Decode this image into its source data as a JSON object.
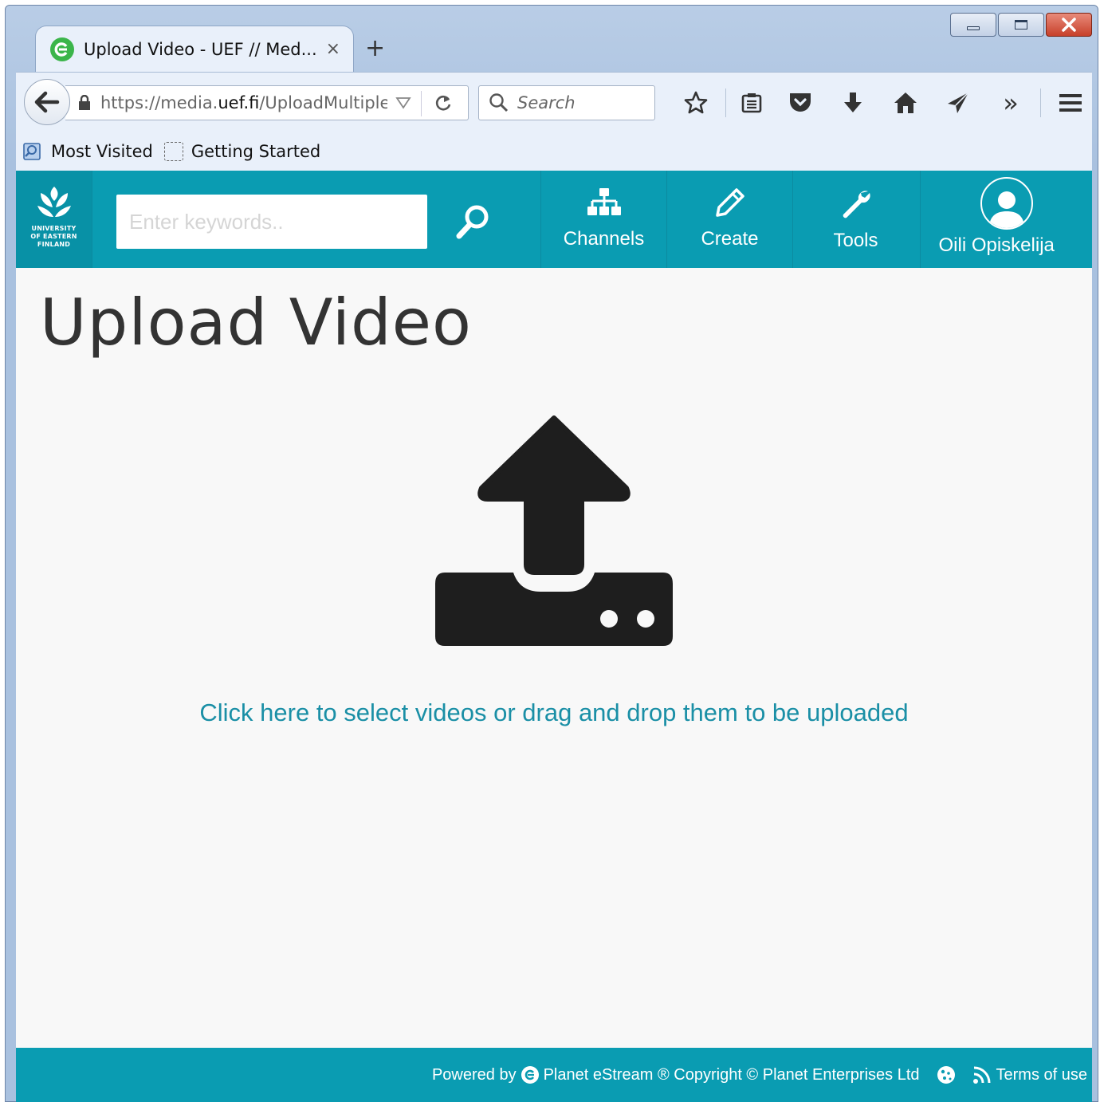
{
  "browser": {
    "tab_title": "Upload Video - UEF // Med...",
    "tab_close": "×",
    "new_tab": "+",
    "url_prefix": "https://media.",
    "url_domain": "uef.fi",
    "url_path": "/UploadMultiple",
    "search_placeholder": "Search",
    "bookmarks": [
      "Most Visited",
      "Getting Started"
    ],
    "overflow": "»"
  },
  "site": {
    "logo_lines": [
      "UNIVERSITY",
      "OF EASTERN",
      "FINLAND"
    ],
    "search_placeholder": "Enter keywords..",
    "menu": [
      "Channels",
      "Create",
      "Tools"
    ],
    "user": "Oili Opiskelija"
  },
  "main": {
    "title": "Upload Video",
    "upload_prompt": "Click here to select videos or drag and drop them to be uploaded"
  },
  "footer": {
    "powered_by": "Powered by",
    "product": "Planet eStream ® Copyright © Planet Enterprises Ltd",
    "terms": "Terms of use"
  },
  "colors": {
    "brand": "#0a9cb2",
    "link": "#1a8fa6"
  }
}
